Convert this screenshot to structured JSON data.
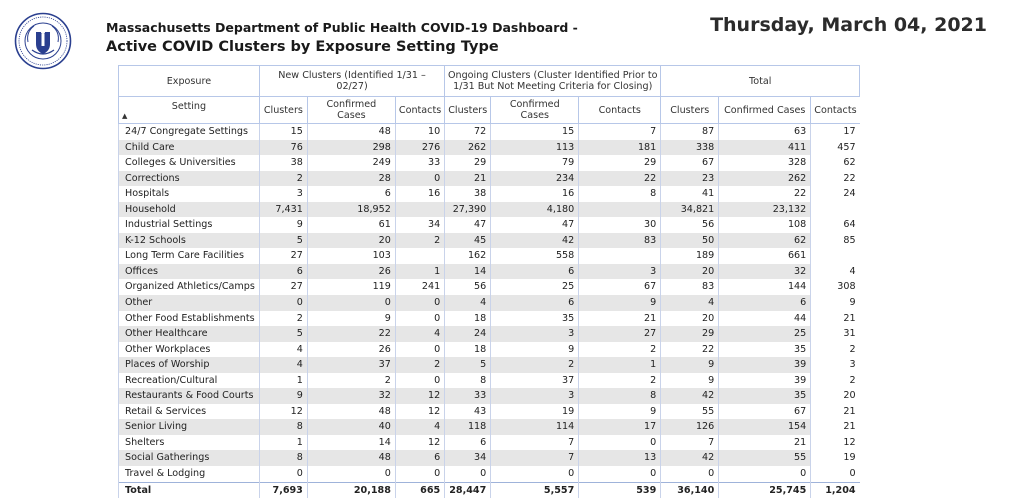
{
  "header": {
    "title_line1": "Massachusetts Department of Public Health COVID-19 Dashboard -",
    "title_line2": "Active COVID Clusters by Exposure Setting Type",
    "date": "Thursday, March 04, 2021"
  },
  "table": {
    "group_headers": {
      "exposure": "Exposure",
      "new": "New Clusters (Identified 1/31 – 02/27)",
      "ongoing": "Ongoing Clusters (Cluster Identified Prior to 1/31 But Not Meeting Criteria for Closing)",
      "total": "Total"
    },
    "column_headers": [
      "Setting",
      "Clusters",
      "Confirmed Cases",
      "Contacts",
      "Clusters",
      "Confirmed Cases",
      "Contacts",
      "Clusters",
      "Confirmed Cases",
      "Contacts"
    ],
    "rows": [
      [
        "24/7 Congregate Settings",
        "15",
        "48",
        "10",
        "72",
        "15",
        "7",
        "87",
        "63",
        "17"
      ],
      [
        "Child Care",
        "76",
        "298",
        "276",
        "262",
        "113",
        "181",
        "338",
        "411",
        "457"
      ],
      [
        "Colleges & Universities",
        "38",
        "249",
        "33",
        "29",
        "79",
        "29",
        "67",
        "328",
        "62"
      ],
      [
        "Corrections",
        "2",
        "28",
        "0",
        "21",
        "234",
        "22",
        "23",
        "262",
        "22"
      ],
      [
        "Hospitals",
        "3",
        "6",
        "16",
        "38",
        "16",
        "8",
        "41",
        "22",
        "24"
      ],
      [
        "Household",
        "7,431",
        "18,952",
        "",
        "27,390",
        "4,180",
        "",
        "34,821",
        "23,132",
        ""
      ],
      [
        "Industrial Settings",
        "9",
        "61",
        "34",
        "47",
        "47",
        "30",
        "56",
        "108",
        "64"
      ],
      [
        "K-12 Schools",
        "5",
        "20",
        "2",
        "45",
        "42",
        "83",
        "50",
        "62",
        "85"
      ],
      [
        "Long Term Care Facilities",
        "27",
        "103",
        "",
        "162",
        "558",
        "",
        "189",
        "661",
        ""
      ],
      [
        "Offices",
        "6",
        "26",
        "1",
        "14",
        "6",
        "3",
        "20",
        "32",
        "4"
      ],
      [
        "Organized Athletics/Camps",
        "27",
        "119",
        "241",
        "56",
        "25",
        "67",
        "83",
        "144",
        "308"
      ],
      [
        "Other",
        "0",
        "0",
        "0",
        "4",
        "6",
        "9",
        "4",
        "6",
        "9"
      ],
      [
        "Other Food Establishments",
        "2",
        "9",
        "0",
        "18",
        "35",
        "21",
        "20",
        "44",
        "21"
      ],
      [
        "Other Healthcare",
        "5",
        "22",
        "4",
        "24",
        "3",
        "27",
        "29",
        "25",
        "31"
      ],
      [
        "Other Workplaces",
        "4",
        "26",
        "0",
        "18",
        "9",
        "2",
        "22",
        "35",
        "2"
      ],
      [
        "Places of Worship",
        "4",
        "37",
        "2",
        "5",
        "2",
        "1",
        "9",
        "39",
        "3"
      ],
      [
        "Recreation/Cultural",
        "1",
        "2",
        "0",
        "8",
        "37",
        "2",
        "9",
        "39",
        "2"
      ],
      [
        "Restaurants & Food Courts",
        "9",
        "32",
        "12",
        "33",
        "3",
        "8",
        "42",
        "35",
        "20"
      ],
      [
        "Retail & Services",
        "12",
        "48",
        "12",
        "43",
        "19",
        "9",
        "55",
        "67",
        "21"
      ],
      [
        "Senior Living",
        "8",
        "40",
        "4",
        "118",
        "114",
        "17",
        "126",
        "154",
        "21"
      ],
      [
        "Shelters",
        "1",
        "14",
        "12",
        "6",
        "7",
        "0",
        "7",
        "21",
        "12"
      ],
      [
        "Social Gatherings",
        "8",
        "48",
        "6",
        "34",
        "7",
        "13",
        "42",
        "55",
        "19"
      ],
      [
        "Travel & Lodging",
        "0",
        "0",
        "0",
        "0",
        "0",
        "0",
        "0",
        "0",
        "0"
      ]
    ],
    "total_row": [
      "Total",
      "7,693",
      "20,188",
      "665",
      "28,447",
      "5,557",
      "539",
      "36,140",
      "25,745",
      "1,204"
    ]
  },
  "colors": {
    "header_border": "#b7c7e8",
    "row_band": "#e6e6e6",
    "seal_blue": "#2a3f8f"
  },
  "icons": {
    "seal": "massachusetts-seal-icon",
    "sort": "sort-ascending-icon"
  }
}
